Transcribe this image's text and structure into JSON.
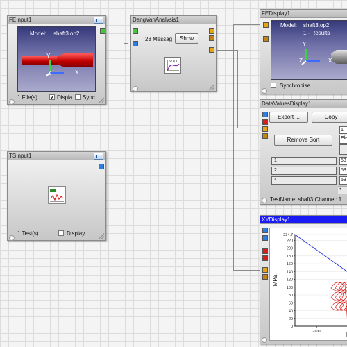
{
  "fe_input": {
    "title": "FEInput1",
    "model_label": "Model:",
    "model_value": "shaft3.op2",
    "files": "1 File(s)",
    "display_label": "Displa",
    "display_checked": "✔",
    "sync_label": "Sync",
    "axis_y": "Y",
    "axis_z": "Z",
    "axis_x": "X"
  },
  "ts_input": {
    "title": "TSInput1",
    "tests": "1 Test(s)",
    "display_label": "Display"
  },
  "dang_van": {
    "title": "DangVanAnalysis1",
    "messages": "28 Messag",
    "show_label": "Show",
    "icon_text": "Sf X3"
  },
  "fe_display": {
    "title": "FEDisplay1",
    "model_label": "Model:",
    "model_value": "shaft3.op2",
    "results": "1 - Results",
    "synchronise_label": "Synchronise",
    "axis_y": "Y",
    "axis_z": "Z",
    "axis_x": "X"
  },
  "data_values": {
    "title": "DataValuesDisplay1",
    "export_label": "Export ...",
    "copy_label": "Copy",
    "remove_sort_label": "Remove Sort",
    "header_top": "1",
    "header_ele": "Ele",
    "rows": [
      {
        "index": "1",
        "value": "53"
      },
      {
        "index": "2",
        "value": "53"
      },
      {
        "index": "4",
        "value": "53"
      }
    ],
    "status": "TestName: shaft3  Channel: 1"
  },
  "xy_display": {
    "title": "XYDisplay1",
    "ylabel": "MPa",
    "xlabel": "H"
  },
  "colors": {
    "port_green": "#46c63b",
    "port_blue": "#2f7de0",
    "port_orange": "#e6a416",
    "port_red": "#d51f1f",
    "active_title": "#1a1af5",
    "plot_line": "#2b3bd6",
    "plot_red": "#e01616"
  },
  "chart_data": {
    "type": "line",
    "title": "",
    "xlabel": "H",
    "ylabel": "MPa",
    "ylim": [
      0,
      234.7
    ],
    "xlim": [
      -160,
      0
    ],
    "y_ticks": [
      "234.7",
      "220",
      "200",
      "180",
      "160",
      "140",
      "120",
      "100",
      "80",
      "60",
      "40",
      "20",
      "0"
    ],
    "x_ticks": [
      "-100",
      "0"
    ],
    "series": [
      {
        "x": [
          -160,
          0
        ],
        "y": [
          234.7,
          130
        ]
      }
    ]
  }
}
